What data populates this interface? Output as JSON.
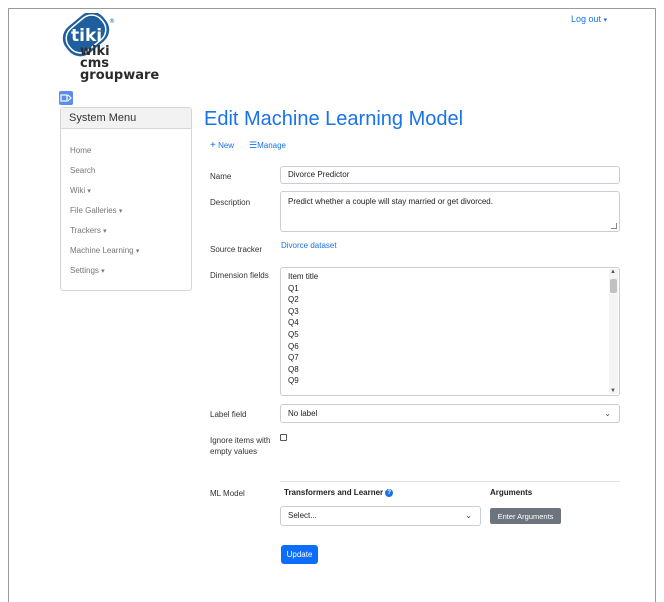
{
  "header": {
    "logo_text": [
      "wiki",
      "cms",
      "groupware"
    ],
    "logo_badge": "tiki",
    "logout_label": "Log out"
  },
  "menu": {
    "title": "System Menu",
    "items": [
      {
        "label": "Home",
        "caret": false
      },
      {
        "label": "Search",
        "caret": false
      },
      {
        "label": "Wiki",
        "caret": true
      },
      {
        "label": "File Galleries",
        "caret": true
      },
      {
        "label": "Trackers",
        "caret": true
      },
      {
        "label": "Machine Learning",
        "caret": true
      },
      {
        "label": "Settings",
        "caret": true
      }
    ]
  },
  "page": {
    "title": "Edit Machine Learning Model",
    "new_label": "New",
    "manage_label": "Manage"
  },
  "form": {
    "name_label": "Name",
    "name_value": "Divorce Predictor",
    "description_label": "Description",
    "description_value": "Predict whether a couple will stay married or get divorced.",
    "source_label": "Source tracker",
    "source_value": "Divorce dataset",
    "dimension_label": "Dimension fields",
    "dimension_options": [
      "Item title",
      "Q1",
      "Q2",
      "Q3",
      "Q4",
      "Q5",
      "Q6",
      "Q7",
      "Q8",
      "Q9"
    ],
    "label_field_label": "Label field",
    "label_field_value": "No label",
    "ignore_label": "Ignore items with empty values",
    "ml_model_label": "ML Model",
    "col_transformers": "Transformers and Learner",
    "col_arguments": "Arguments",
    "model_select_value": "Select...",
    "enter_args_label": "Enter Arguments",
    "update_label": "Update"
  },
  "colors": {
    "accent": "#1a73e8",
    "primary_button": "#0d6efd",
    "secondary_button": "#6c757d"
  }
}
